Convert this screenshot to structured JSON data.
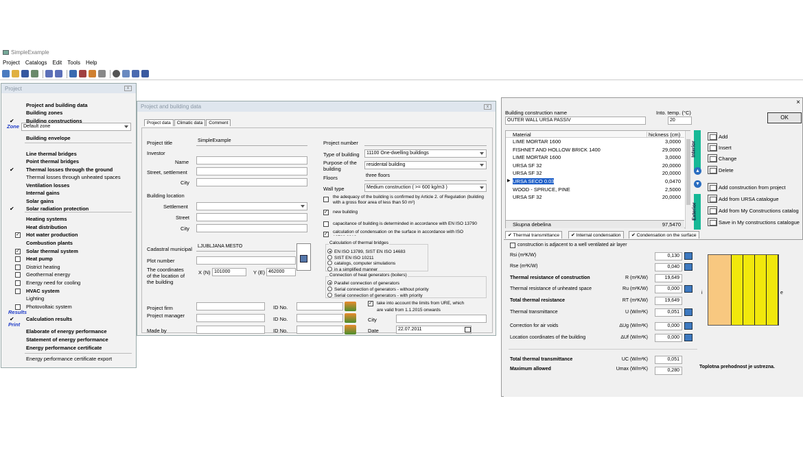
{
  "app": {
    "title": "SimpleExample",
    "menu": [
      "Project",
      "Catalogs",
      "Edit",
      "Tools",
      "Help"
    ]
  },
  "project_panel": {
    "title": "Project",
    "zone_label": "Zone",
    "zone_value": "Default zone",
    "items": [
      {
        "label": "Project and building data",
        "bold": true,
        "check": ""
      },
      {
        "label": "Building zones",
        "bold": true,
        "check": ""
      },
      {
        "label": "Building constructions",
        "bold": true,
        "check": "✔"
      },
      {
        "label": "Building envelope",
        "bold": true,
        "check": ""
      },
      {
        "label": "Line thermal bridges",
        "bold": true,
        "check": ""
      },
      {
        "label": "Point thermal bridges",
        "bold": true,
        "check": ""
      },
      {
        "label": "Thermal losses through the ground",
        "bold": true,
        "check": "✔"
      },
      {
        "label": "Thermal losses through unheated spaces",
        "bold": false,
        "check": ""
      },
      {
        "label": "Ventilation losses",
        "bold": true,
        "check": ""
      },
      {
        "label": "Internal gains",
        "bold": true,
        "check": ""
      },
      {
        "label": "Solar gains",
        "bold": true,
        "check": ""
      },
      {
        "label": "Solar radiation protection",
        "bold": true,
        "check": "✔"
      },
      {
        "label": "Heating systems",
        "bold": true,
        "check": ""
      },
      {
        "label": "Heat distribution",
        "bold": true,
        "check": ""
      },
      {
        "label": "Hot water production",
        "bold": true,
        "box": "☑"
      },
      {
        "label": "Combustion plants",
        "bold": true,
        "check": ""
      },
      {
        "label": "Solar thermal system",
        "bold": true,
        "box": "☑"
      },
      {
        "label": "Heat pump",
        "bold": true,
        "box": "☐"
      },
      {
        "label": "District heating",
        "bold": false,
        "box": "☐"
      },
      {
        "label": "Geothermal energy",
        "bold": false,
        "box": "☐"
      },
      {
        "label": "Energy need for cooling",
        "bold": false,
        "box": "☐"
      },
      {
        "label": "HVAC system",
        "bold": true,
        "box": "☐"
      },
      {
        "label": "Lighting",
        "bold": false,
        "check": ""
      },
      {
        "label": "Photovoltaic system",
        "bold": false,
        "box": "☐"
      }
    ],
    "results_label": "Results",
    "calc_results": "Calculation results",
    "print_label": "Print",
    "print_items": [
      "Elaborate of energy performance",
      "Statement of energy performance",
      "Energy performance certificate",
      "Energy performance certificate export"
    ]
  },
  "project_dialog": {
    "title": "Project and building data",
    "tabs": [
      "Project data",
      "Climatic data",
      "Comment"
    ],
    "project_title_label": "Project title",
    "project_title": "SimpleExample",
    "investor": "Investor",
    "name": "Name",
    "street_settlement": "Street, settlement",
    "city": "City",
    "building_location": "Building location",
    "settlement": "Settlement",
    "street": "Street",
    "city2": "City",
    "cadastral": "Cadastral municipal",
    "cadastral_value": "LJUBLJANA MESTO",
    "plot": "Plot number",
    "coord_label": "The coordinates of the location of the building",
    "x_label": "X (N)",
    "x_value": "101000",
    "y_label": "Y (E)",
    "y_value": "462000",
    "project_firm": "Project firm",
    "project_manager": "Project manager",
    "made_by": "Made by",
    "id_no": "ID No.",
    "project_number": "Project number",
    "type_label": "Type of building",
    "type_value": "11100 One-dwelling buildings",
    "purpose_label": "Purpose of the building",
    "purpose_value": "residental building",
    "floors_label": "Floors",
    "floors_value": "three floors",
    "wall_label": "Wall type",
    "wall_value": "Medium construction  ( >= 600 kg/m3 )",
    "adequacy": "the adequacy of the building is confirmed by Article 2. of Regulation (building with a gross floor area of less than 50 m²)",
    "new_building": "new building",
    "capacitance": "capacitance of building is determinded in accordance with EN ISO 13790",
    "condensation": "calculation of condensation on the surface in accordance with ISO 13788:2012",
    "bridges_title": "Calculation of thermal bridges",
    "bridges": [
      "EN ISO 13789, SIST EN ISO 14683",
      "SIST EN ISO 10211",
      "catalogs, computer simulations",
      "in a simplified manner"
    ],
    "generators_title": "Connection of heat generators (boilers)",
    "generators": [
      "Parallel connection of generators",
      "Serial connection of generators - without priority",
      "Serial connection of generators - with priority"
    ],
    "limits": "take into account the limits from URE, which are valid from 1.1.2015 onwards",
    "city_label": "City",
    "date_label": "Date",
    "date_value": "22.07.2011"
  },
  "construction": {
    "name_label": "Building construction name",
    "name_value": "OUTER WALL URSA PASSIV",
    "temp_label": "Into. temp. (°C)",
    "temp_value": "20",
    "ok": "OK",
    "col_material": "Material",
    "col_thickness": "hickness (cm)",
    "rows": [
      {
        "m": "LIME MORTAR 1600",
        "t": "3,0000"
      },
      {
        "m": "FISHNET AND HOLLOW BRICK 1400",
        "t": "29,0000"
      },
      {
        "m": "LIME MORTAR 1600",
        "t": "3,0000"
      },
      {
        "m": "URSA SF 32",
        "t": "20,0000"
      },
      {
        "m": "URSA SF 32",
        "t": "20,0000"
      },
      {
        "m": "URSA SECO 0.03",
        "t": "0,0470"
      },
      {
        "m": "WOOD - SPRUCE, PINE",
        "t": "2,5000"
      },
      {
        "m": "URSA SF 32",
        "t": "20,0000"
      }
    ],
    "total_label": "Skupna debelina",
    "total_value": "97,5470",
    "interior": "Interior",
    "exterior": "Exterior",
    "buttons": [
      "Add",
      "Insert",
      "Change",
      "Delete",
      "Add construction from project",
      "Add from URSA catalogue",
      "Add from My Constructions catalog",
      "Save in My constructions catalogue"
    ],
    "tabs": [
      "Thermal transmittance",
      "Internal condensation",
      "Condensation on the surface"
    ],
    "adjacent": "construction is adjacent to a well ventilated air layer",
    "rsi_label": "Rsi (m²K/W)",
    "rsi": "0,130",
    "rse_label": "Rse (m²K/W)",
    "rse": "0,040",
    "rc_label": "Thermal resistance of construction",
    "rc_sym": "R (m²K/W)",
    "rc": "19,649",
    "ru_label": "Thermal resistance of unheated space",
    "ru_sym": "Ru (m²K/W)",
    "ru": "0,000",
    "rt_label": "Total thermal resistance",
    "rt_sym": "RT (m²K/W)",
    "rt": "19,649",
    "u_label": "Thermal transmittance",
    "u_sym": "U (W/m²K)",
    "u": "0,051",
    "dug_label": "Correction for air voids",
    "dug_sym": "ΔUg (W/m²K)",
    "dug": "0,000",
    "duf_label": "Location coordinates of the building",
    "duf_sym": "ΔUf (W/m²K)",
    "duf": "0,000",
    "uc_label": "Total thermal transmittance",
    "uc_sym": "UC (W/m²K)",
    "uc": "0,051",
    "umax_label": "Maximum allowed",
    "umax_sym": "Umax (W/m²K)",
    "umax": "0,280",
    "verdict": "Toplotna prehodnost je ustrezna.",
    "i_label": "i",
    "e_label": "e",
    "layer_colors": [
      "#f8c880",
      "#f1e80c",
      "#f1e80c",
      "#f1e80c",
      "#f1e80c"
    ]
  }
}
